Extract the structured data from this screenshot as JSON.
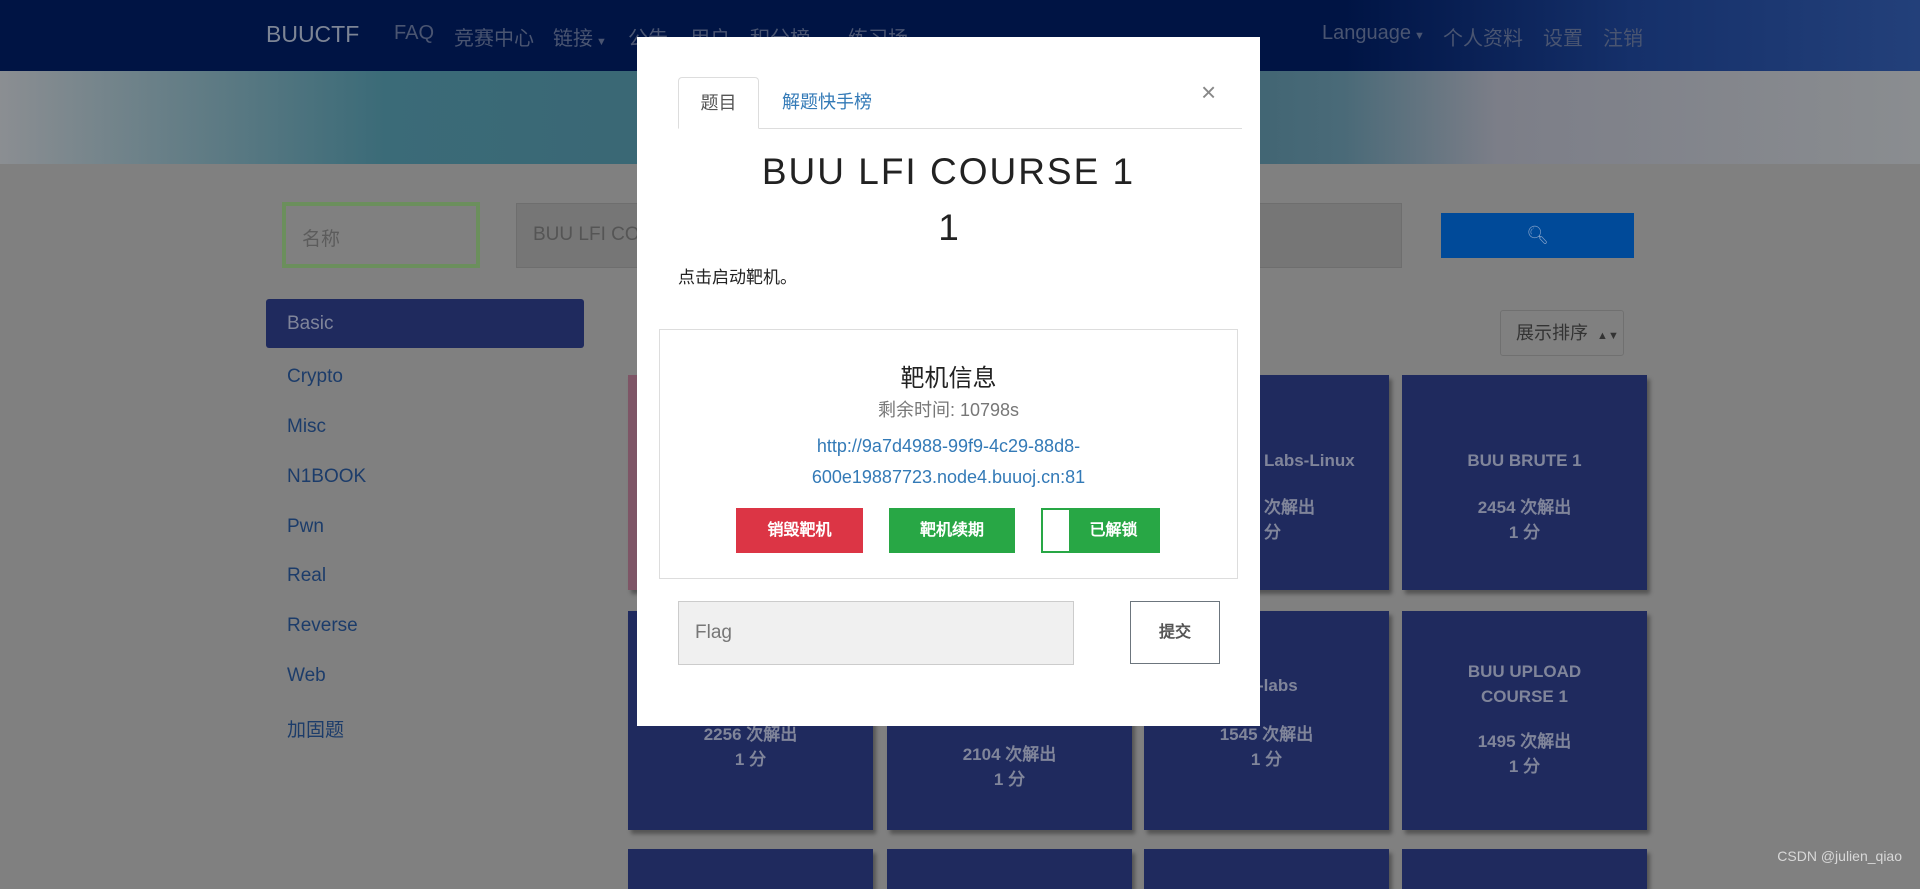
{
  "navbar": {
    "brand": "BUUCTF",
    "items": [
      "FAQ",
      "竞赛中心",
      "链接",
      "公告",
      "用户",
      "积分榜",
      "练习场"
    ],
    "right": [
      "Language",
      "个人资料",
      "设置",
      "注销"
    ]
  },
  "search": {
    "name_placeholder": "名称",
    "query_value": "BUU LFI CO",
    "button_icon": "search-icon"
  },
  "sidebar": {
    "items": [
      "Basic",
      "Crypto",
      "Misc",
      "N1BOOK",
      "Pwn",
      "Real",
      "Reverse",
      "Web",
      "加固题"
    ],
    "active": "Basic"
  },
  "sort": {
    "label": "展示排序"
  },
  "cards": [
    {
      "title": "",
      "solves": "",
      "points": "",
      "color": "#7e5566"
    },
    {
      "title": "",
      "solves": "",
      "points": ""
    },
    {
      "title": "Labs-Linux",
      "solves": "次解出",
      "points": "分"
    },
    {
      "title": "BUU BRUTE 1",
      "solves": "2454 次解出",
      "points": "1 分"
    },
    {
      "title": "",
      "solves": "2256 次解出",
      "points": "1 分"
    },
    {
      "title": "",
      "solves": "2104 次解出",
      "points": "1 分"
    },
    {
      "title": "-labs",
      "solves": "1545 次解出",
      "points": "1 分"
    },
    {
      "title": "BUU UPLOAD COURSE 1",
      "solves": "1495 次解出",
      "points": "1 分"
    }
  ],
  "modal": {
    "tabs": [
      "题目",
      "解题快手榜"
    ],
    "active_tab": "题目",
    "close": "×",
    "title": "BUU LFI COURSE 1",
    "points": "1",
    "description": "点击启动靶机。",
    "target": {
      "heading": "靶机信息",
      "time_left": "剩余时间: 10798s",
      "url_line1": "http://9a7d4988-99f9-4c29-88d8-",
      "url_line2": "600e19887723.node4.buuoj.cn:81",
      "destroy": "销毁靶机",
      "renew": "靶机续期",
      "unlock": "已解锁",
      "unlock_toggle": true
    },
    "flag_placeholder": "Flag",
    "submit": "提交"
  },
  "watermark": "CSDN @julien_qiao",
  "colors": {
    "navbar": "#001444",
    "card": "#1f2a5e",
    "danger": "#dc3545",
    "success": "#28a745",
    "link": "#337ab7"
  }
}
